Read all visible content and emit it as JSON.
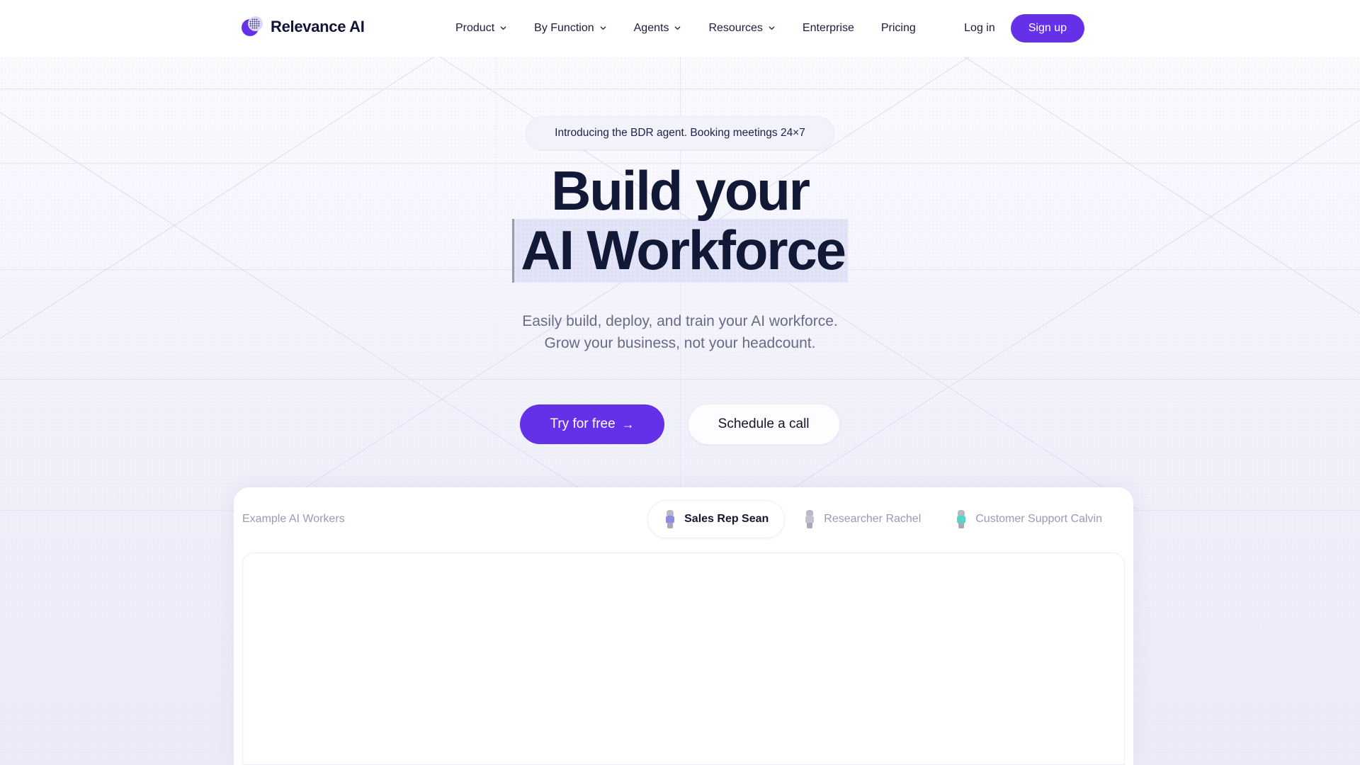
{
  "header": {
    "brand_name": "Relevance AI",
    "logo_icon": "relevance-logo-icon",
    "nav": [
      {
        "label": "Product",
        "has_chevron": true
      },
      {
        "label": "By Function",
        "has_chevron": true
      },
      {
        "label": "Agents",
        "has_chevron": true
      },
      {
        "label": "Resources",
        "has_chevron": true
      },
      {
        "label": "Enterprise",
        "has_chevron": false
      },
      {
        "label": "Pricing",
        "has_chevron": false
      }
    ],
    "login_label": "Log in",
    "signup_label": "Sign up"
  },
  "hero": {
    "announcement": "Introducing the BDR agent. Booking meetings 24×7",
    "headline_line1": "Build your",
    "headline_line2": "AI Workforce",
    "subtitle_line1": "Easily build, deploy, and train your AI workforce.",
    "subtitle_line2": "Grow your business, not your headcount.",
    "cta_primary": "Try for free",
    "cta_primary_arrow": "→",
    "cta_secondary": "Schedule a call"
  },
  "workers": {
    "section_label": "Example AI Workers",
    "tabs": [
      {
        "label": "Sales Rep Sean",
        "avatar": "avatar-sales-rep-sean",
        "active": true
      },
      {
        "label": "Researcher Rachel",
        "avatar": "avatar-researcher-rachel",
        "active": false
      },
      {
        "label": "Customer Support Calvin",
        "avatar": "avatar-customer-support-calvin",
        "active": false
      }
    ]
  },
  "colors": {
    "accent_purple": "#6531e8",
    "headline_navy": "#111936",
    "muted_text": "#9a9ab5",
    "subtitle_gray": "#6a6a86",
    "hero_bg_top": "#fbfbfe",
    "hero_bg_bottom": "#ececf9",
    "highlight_lavender": "#e4e4f8"
  }
}
